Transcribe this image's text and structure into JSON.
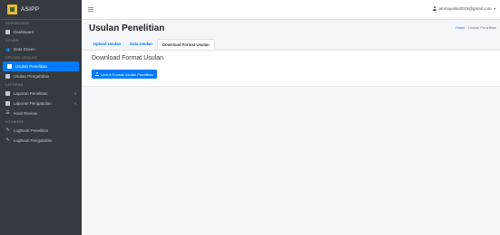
{
  "brand": {
    "name": "ASIPP"
  },
  "sidebar": {
    "sections": [
      {
        "header": "DASHBOARD",
        "items": [
          {
            "label": "Dashboard",
            "icon": "dashboard-icon"
          }
        ]
      },
      {
        "header": "DOSEN",
        "items": [
          {
            "label": "Data Dosen",
            "icon": "users-icon"
          }
        ]
      },
      {
        "header": "Upload Usulan",
        "items": [
          {
            "label": "Usulan Penelitian",
            "icon": "file-icon",
            "active": true
          },
          {
            "label": "Usulan Pengabdian",
            "icon": "file-icon"
          }
        ]
      },
      {
        "header": "LAPORAN",
        "items": [
          {
            "label": "Laporan Penelitian",
            "icon": "document-icon",
            "chevron": "‹"
          },
          {
            "label": "Laporan Pengabdian",
            "icon": "document-icon",
            "chevron": "‹"
          },
          {
            "label": "Hasil Review",
            "icon": "list-icon"
          }
        ]
      },
      {
        "header": "LOGBOOK",
        "items": [
          {
            "label": "Logbook Penelitian",
            "icon": "edit-icon"
          },
          {
            "label": "Logbook Pengabdian",
            "icon": "edit-icon"
          }
        ]
      }
    ]
  },
  "topbar": {
    "user_email": "ammayalmi2019@gmail.com"
  },
  "page": {
    "title": "Usulan Penelitian",
    "breadcrumb": {
      "home": "Home",
      "separator": "/",
      "current": "Usulan Penelitian"
    },
    "tabs": [
      {
        "label": "Upload Usulan",
        "active": false
      },
      {
        "label": "Data Usulan",
        "active": false
      },
      {
        "label": "Download Format Usulan",
        "active": true
      }
    ],
    "card": {
      "title": "Download Format Usulan",
      "button_label": "Unduh Format Usulan Penelitian"
    }
  },
  "colors": {
    "sidebar_bg": "#343a40",
    "accent": "#007bff",
    "page_bg": "#f4f6f9"
  }
}
